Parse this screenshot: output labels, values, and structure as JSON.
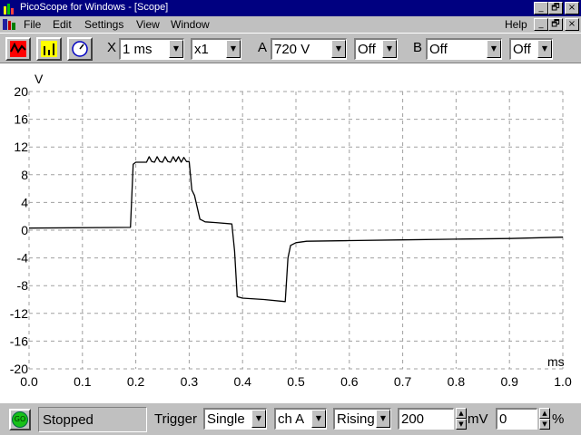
{
  "window": {
    "title": "PicoScope for Windows - [Scope]",
    "minimize_glyph": "_",
    "restore_glyph": "🗗",
    "close_glyph": "×"
  },
  "menu": {
    "file": "File",
    "edit": "Edit",
    "settings": "Settings",
    "view": "View",
    "window": "Window",
    "help": "Help"
  },
  "toolbar": {
    "scope_icon": "scope-mode-icon",
    "spectrum_icon": "spectrum-mode-icon",
    "meter_icon": "meter-mode-icon",
    "x_label": "X",
    "timebase": "1 ms",
    "multiplier": "x1",
    "a_label": "A",
    "a_range": "720 V",
    "a_mode": "Off",
    "b_label": "B",
    "b_range": "Off",
    "b_mode": "Off"
  },
  "status": {
    "go_label": "GO",
    "state": "Stopped",
    "trigger_label": "Trigger",
    "trigger_mode": "Single",
    "trigger_channel": "ch A",
    "trigger_edge": "Rising",
    "trigger_level": "200",
    "trigger_level_unit": "mV",
    "pretrigger": "0",
    "pretrigger_unit": "%"
  },
  "colors": {
    "titlebar": "#000080",
    "face": "#c0c0c0",
    "plot_bg": "#ffffff",
    "grid": "#a0a0a0",
    "trace": "#000000",
    "go_led": "#18c018"
  },
  "chart_data": {
    "type": "line",
    "xlabel": "ms",
    "ylabel": "V",
    "xlim": [
      0.0,
      1.0
    ],
    "ylim": [
      -20,
      20
    ],
    "x_ticks": [
      "0.0",
      "0.1",
      "0.2",
      "0.3",
      "0.4",
      "0.5",
      "0.6",
      "0.7",
      "0.8",
      "0.9",
      "1.0"
    ],
    "y_ticks": [
      "20",
      "16",
      "12",
      "8",
      "4",
      "0",
      "-4",
      "-8",
      "-12",
      "-16",
      "-20"
    ],
    "grid": true,
    "series": [
      {
        "x": [
          0.0,
          0.19,
          0.195,
          0.2,
          0.21,
          0.22,
          0.225,
          0.23,
          0.235,
          0.24,
          0.245,
          0.25,
          0.255,
          0.26,
          0.265,
          0.27,
          0.275,
          0.28,
          0.285,
          0.29,
          0.295,
          0.3,
          0.305,
          0.31,
          0.32,
          0.33,
          0.35,
          0.38,
          0.385,
          0.39,
          0.4,
          0.44,
          0.48,
          0.485,
          0.49,
          0.5,
          0.52,
          0.6,
          0.7,
          0.8,
          0.9,
          1.0
        ],
        "y": [
          0.3,
          0.4,
          9.5,
          9.8,
          9.8,
          9.8,
          10.6,
          9.9,
          9.8,
          10.6,
          9.9,
          9.8,
          10.6,
          9.9,
          9.8,
          10.6,
          9.9,
          10.6,
          9.8,
          10.5,
          9.9,
          9.9,
          5.8,
          5.0,
          1.6,
          1.2,
          1.1,
          0.9,
          -3.0,
          -9.6,
          -9.8,
          -10.0,
          -10.3,
          -4.0,
          -2.2,
          -1.8,
          -1.6,
          -1.5,
          -1.4,
          -1.3,
          -1.2,
          -1.0
        ]
      }
    ]
  }
}
